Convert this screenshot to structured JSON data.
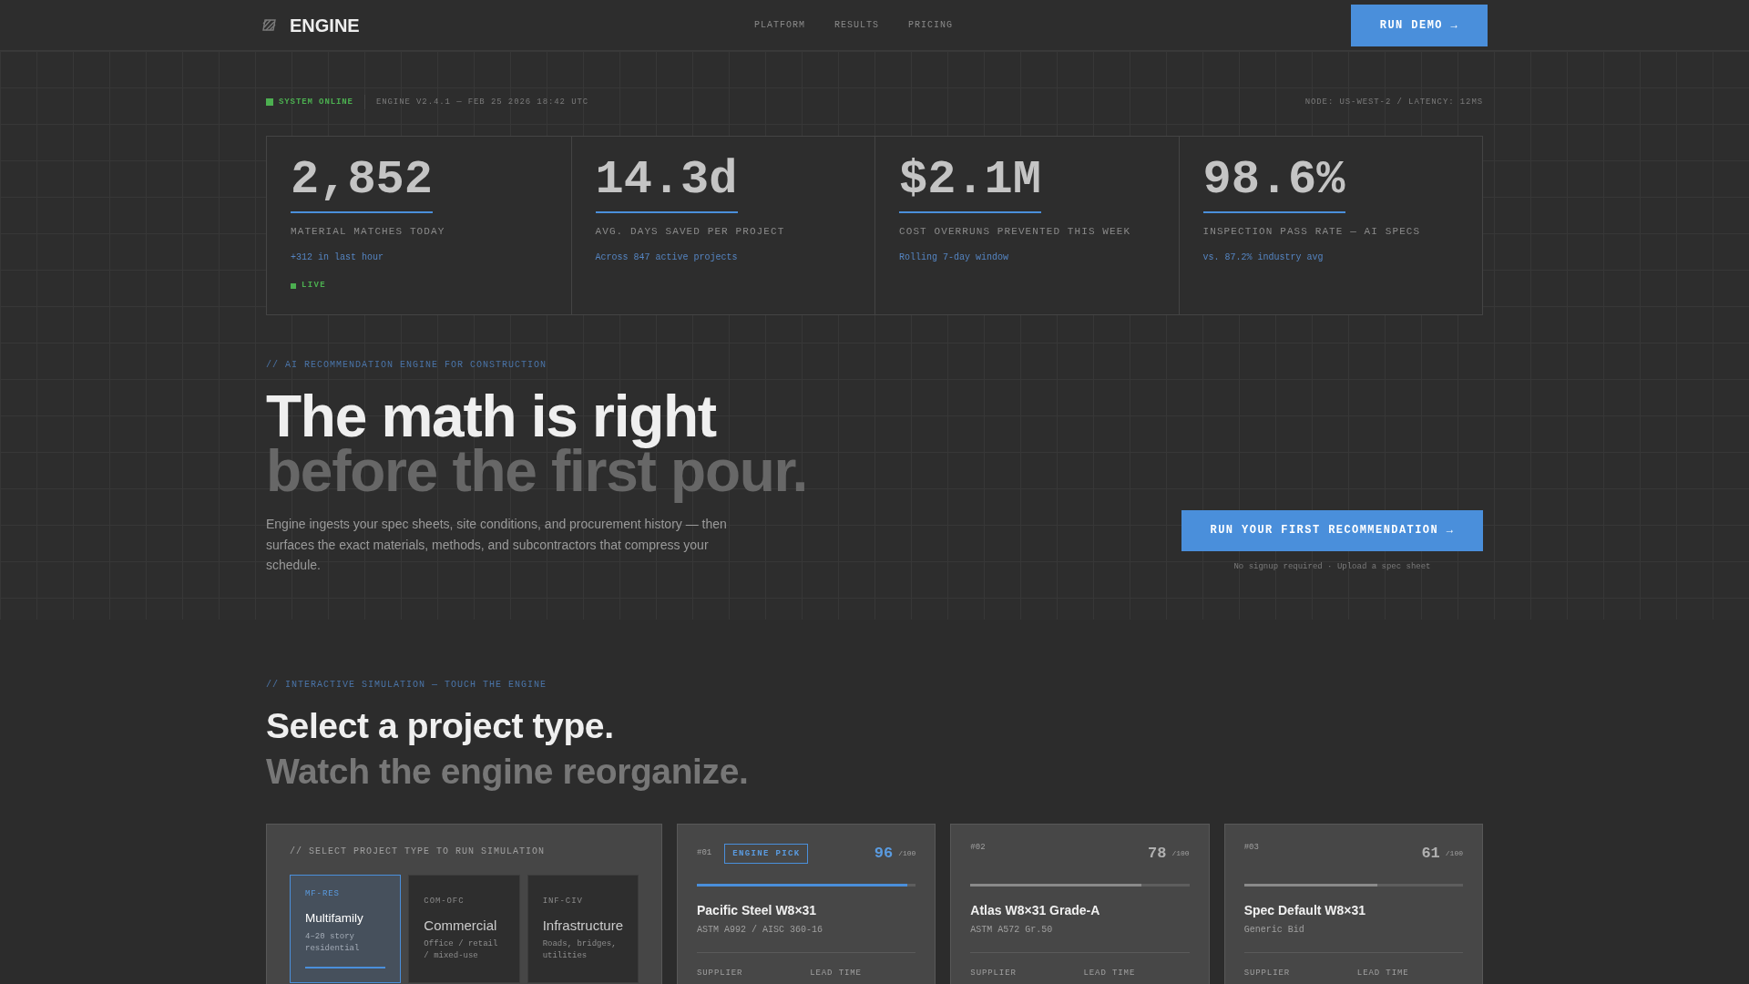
{
  "nav": {
    "brand": "ENGINE",
    "links": [
      "PLATFORM",
      "RESULTS",
      "PRICING"
    ],
    "cta": "RUN DEMO →"
  },
  "status_bar": {
    "status": "SYSTEM ONLINE",
    "online": true,
    "build": "ENGINE V2.4.1 — FEB 25 2026 18:42 UTC",
    "node": "NODE: US-WEST-2 / LATENCY: 12MS"
  },
  "stats": [
    {
      "value": "2,852",
      "label": "MATERIAL MATCHES TODAY",
      "note": "+312 in last hour",
      "live": "LIVE"
    },
    {
      "value": "14.3d",
      "label": "AVG. DAYS SAVED PER PROJECT",
      "note": "Across 847 active projects"
    },
    {
      "value": "$2.1M",
      "label": "COST OVERRUNS PREVENTED THIS WEEK",
      "note": "Rolling 7-day window"
    },
    {
      "value": "98.6%",
      "label": "INSPECTION PASS RATE — AI SPECS",
      "note": "vs. 87.2% industry avg"
    }
  ],
  "hero": {
    "eyebrow": "// AI RECOMMENDATION ENGINE FOR CONSTRUCTION",
    "headline": "The math is right",
    "headline_muted": "before the first pour.",
    "body": "Engine ingests your spec sheets, site conditions, and procurement history — then surfaces the exact materials, methods, and subcontractors that compress your schedule.",
    "cta": "RUN YOUR FIRST RECOMMENDATION →",
    "cta_note": "No signup required · Upload a spec sheet"
  },
  "simulation": {
    "eyebrow": "// INTERACTIVE SIMULATION — TOUCH THE ENGINE",
    "title": "Select a project type.",
    "subtitle": "Watch the engine reorganize.",
    "picker": {
      "heading": "// SELECT PROJECT TYPE TO RUN SIMULATION",
      "types": [
        {
          "code": "MF-RES",
          "name": "Multifamily",
          "description": "4–20 story residential",
          "selected": true
        },
        {
          "code": "COM-OFC",
          "name": "Commercial",
          "description": "Office / retail / mixed-use",
          "selected": false
        },
        {
          "code": "INF-CIV",
          "name": "Infrastructure",
          "description": "Roads, bridges, utilities",
          "selected": false
        }
      ]
    },
    "options": [
      {
        "rank": "#01",
        "badge": "ENGINE PICK",
        "highlighted": true,
        "score": "96",
        "score_max": "/100",
        "level": 0.96,
        "name": "Pacific Steel W8×31",
        "spec": "ASTM A992 / AISC 360-16",
        "fields": [
          "SUPPLIER",
          "LEAD TIME"
        ]
      },
      {
        "rank": "#02",
        "highlighted": false,
        "score": "78",
        "score_max": "/100",
        "level": 0.78,
        "name": "Atlas W8×31 Grade-A",
        "spec": "ASTM A572 Gr.50",
        "fields": [
          "SUPPLIER",
          "LEAD TIME"
        ]
      },
      {
        "rank": "#03",
        "highlighted": false,
        "score": "61",
        "score_max": "/100",
        "level": 0.61,
        "name": "Spec Default W8×31",
        "spec": "Generic Bid",
        "fields": [
          "SUPPLIER",
          "LEAD TIME"
        ]
      }
    ]
  }
}
